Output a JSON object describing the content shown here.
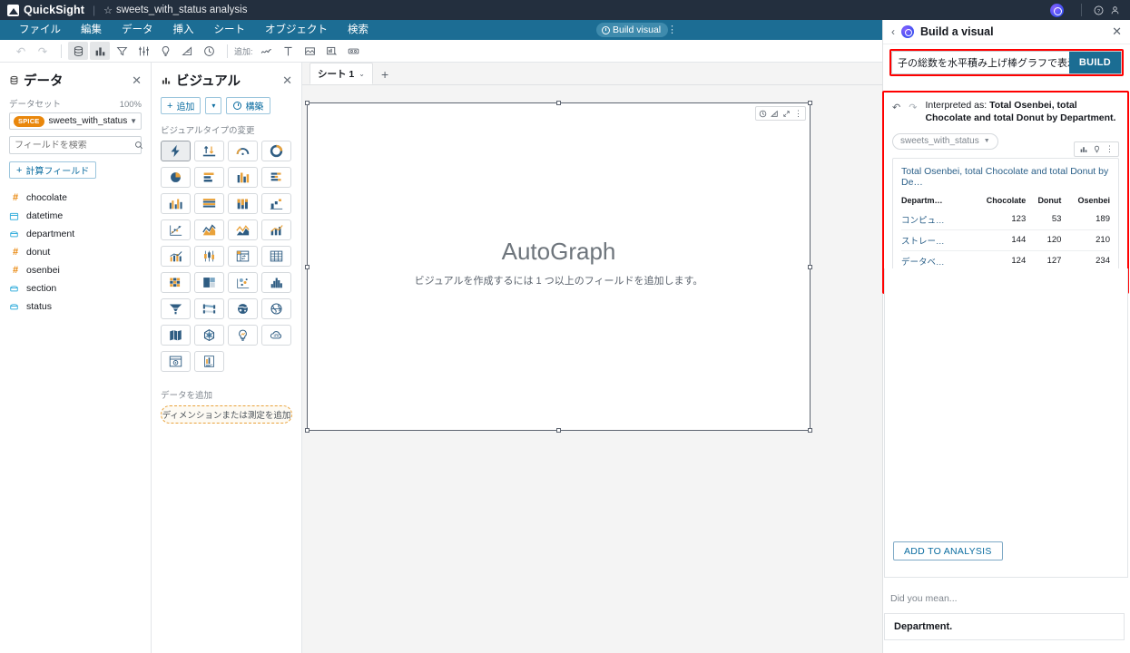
{
  "topbar": {
    "product": "QuickSight",
    "star_icon": "star-icon",
    "analysis_title": "sweets_with_status analysis",
    "q_icon": "quicksight-q-icon",
    "help_icon": "help-icon",
    "account_icon": "account-icon"
  },
  "menubar": {
    "items": [
      {
        "label": "ファイル"
      },
      {
        "label": "編集"
      },
      {
        "label": "データ"
      },
      {
        "label": "挿入"
      },
      {
        "label": "シート"
      },
      {
        "label": "オブジェクト"
      },
      {
        "label": "検索"
      }
    ],
    "build_visual_label": "Build visual",
    "kebab": "⋮"
  },
  "toolbar": {
    "undo": "↶",
    "redo": "↷",
    "icons": [
      {
        "name": "dataset-icon",
        "glyph": "▤"
      },
      {
        "name": "visuals-icon",
        "glyph": "▮▮"
      },
      {
        "name": "filter-icon",
        "glyph": "▽"
      },
      {
        "name": "parameters-icon",
        "glyph": "⇅"
      },
      {
        "name": "insights-icon",
        "glyph": "◌"
      },
      {
        "name": "themes-icon",
        "glyph": "◤"
      },
      {
        "name": "actions-icon",
        "glyph": "◷"
      }
    ],
    "add_label": "追加:",
    "add_icons": [
      {
        "name": "add-visual-icon",
        "glyph": "∿"
      },
      {
        "name": "add-text-icon",
        "glyph": "T"
      },
      {
        "name": "add-image-icon",
        "glyph": "▨"
      },
      {
        "name": "add-insight-icon",
        "glyph": "▥"
      },
      {
        "name": "add-control-icon",
        "glyph": "▭"
      }
    ]
  },
  "data_panel": {
    "title": "データ",
    "close": "✕",
    "dataset_label": "データセット",
    "percent": "100%",
    "spice_badge": "SPICE",
    "dataset_name": "sweets_with_status",
    "search_placeholder": "フィールドを検索",
    "calc_field_label": "計算フィールド",
    "fields": [
      {
        "name": "chocolate",
        "type": "number",
        "glyph": "#"
      },
      {
        "name": "datetime",
        "type": "date",
        "glyph": "▤"
      },
      {
        "name": "department",
        "type": "string",
        "glyph": "▭"
      },
      {
        "name": "donut",
        "type": "number",
        "glyph": "#"
      },
      {
        "name": "osenbei",
        "type": "number",
        "glyph": "#"
      },
      {
        "name": "section",
        "type": "string",
        "glyph": "▭"
      },
      {
        "name": "status",
        "type": "string",
        "glyph": "▭"
      }
    ]
  },
  "visual_panel": {
    "title": "ビジュアル",
    "close": "✕",
    "add_label": "追加",
    "caret": "▾",
    "build_label": "構築",
    "change_type_label": "ビジュアルタイプの変更",
    "visual_types": [
      {
        "name": "autograph",
        "selected": true
      },
      {
        "name": "kpi",
        "selected": false
      },
      {
        "name": "gauge",
        "selected": false
      },
      {
        "name": "donut-chart",
        "selected": false
      },
      {
        "name": "pie-chart",
        "selected": false
      },
      {
        "name": "horizontal-bar-chart",
        "selected": false
      },
      {
        "name": "vertical-bar-chart",
        "selected": false
      },
      {
        "name": "horizontal-stacked-bar-chart",
        "selected": false
      },
      {
        "name": "clustered-bar-chart",
        "selected": false
      },
      {
        "name": "stacked-horizontal-bar",
        "selected": false
      },
      {
        "name": "stacked-vertical-bar",
        "selected": false
      },
      {
        "name": "waterfall-chart",
        "selected": false
      },
      {
        "name": "scatter-plot",
        "selected": false
      },
      {
        "name": "area-line-chart",
        "selected": false
      },
      {
        "name": "stacked-area-chart",
        "selected": false
      },
      {
        "name": "combo-chart",
        "selected": false
      },
      {
        "name": "line-bar-combo",
        "selected": false
      },
      {
        "name": "box-plot",
        "selected": false
      },
      {
        "name": "pivot-table",
        "selected": false
      },
      {
        "name": "table",
        "selected": false
      },
      {
        "name": "heat-map",
        "selected": false
      },
      {
        "name": "tree-map",
        "selected": false
      },
      {
        "name": "network-diagram",
        "selected": false
      },
      {
        "name": "histogram",
        "selected": false
      },
      {
        "name": "funnel-chart",
        "selected": false
      },
      {
        "name": "sankey-diagram",
        "selected": false
      },
      {
        "name": "points-on-map",
        "selected": false
      },
      {
        "name": "filled-map",
        "selected": false
      },
      {
        "name": "geospatial-map",
        "selected": false
      },
      {
        "name": "radar-chart",
        "selected": false
      },
      {
        "name": "insight",
        "selected": false
      },
      {
        "name": "word-cloud",
        "selected": false
      },
      {
        "name": "custom-visual",
        "selected": false
      },
      {
        "name": "text-box",
        "selected": false
      }
    ],
    "add_data_label": "データを追加",
    "drop_zone_label": "ディメンションまたは測定を追加"
  },
  "sheet": {
    "tab_label": "シート 1",
    "tab_caret": "⌄",
    "add_tab": "+",
    "visual_toolbar_icons": [
      {
        "name": "actions-icon",
        "glyph": "◷"
      },
      {
        "name": "format-icon",
        "glyph": "◤"
      },
      {
        "name": "maximize-icon",
        "glyph": "⤢"
      },
      {
        "name": "menu-icon",
        "glyph": "⋮"
      }
    ],
    "autograph_title": "AutoGraph",
    "autograph_subtitle": "ビジュアルを作成するには 1 つ以上のフィールドを追加します。"
  },
  "q_panel": {
    "back_icon": "back-chevron-icon",
    "logo_icon": "quicksight-q-icon",
    "title": "Build a visual",
    "close": "✕",
    "search_query": "子の総数を水平積み上げ棒グラフで表示して",
    "build_button": "BUILD",
    "undo_icon": "undo-icon",
    "redo_icon": "redo-icon",
    "interpreted_prefix": "Interpreted as: ",
    "interpreted_value": "Total Osenbei, total Chocolate and total Donut by Department.",
    "dataset_chip": "sweets_with_status",
    "chip_caret": "▼",
    "card_tool_icons": [
      {
        "name": "chart-type-icon",
        "glyph": "▮▮"
      },
      {
        "name": "insight-bulb-icon",
        "glyph": "◌"
      },
      {
        "name": "card-menu-icon",
        "glyph": "⋮"
      }
    ],
    "visual_title": "Total Osenbei, total Chocolate and total Donut by De…",
    "add_to_analysis": "ADD TO ANALYSIS",
    "did_you_mean_label": "Did you mean...",
    "did_you_mean_item": "Department."
  },
  "chart_data": {
    "type": "table",
    "title": "Total Osenbei, total Chocolate and total Donut by De…",
    "columns": [
      "Departm…",
      "Chocolate",
      "Donut",
      "Osenbei"
    ],
    "rows": [
      [
        "コンピュ…",
        "123",
        "53",
        "189"
      ],
      [
        "ストレー…",
        "144",
        "120",
        "210"
      ],
      [
        "データベ…",
        "124",
        "127",
        "234"
      ]
    ]
  },
  "colors": {
    "topbar_bg": "#232f3e",
    "menubar_bg": "#1c6d94",
    "accent_link": "#0a6ca0",
    "spice_orange": "#e9870c",
    "highlight_red": "#ff0000",
    "build_button_bg": "#1b6d93"
  }
}
